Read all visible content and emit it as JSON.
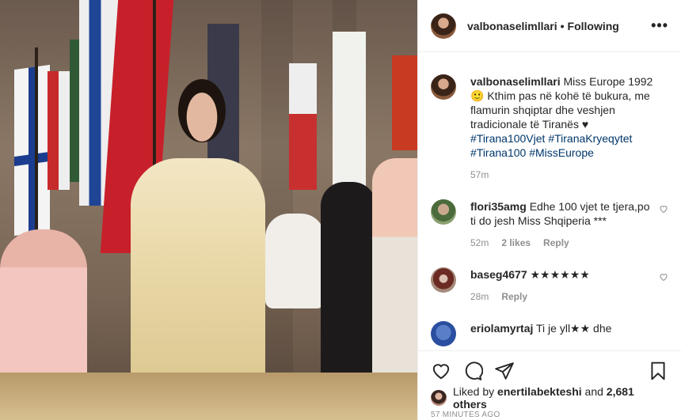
{
  "header": {
    "username": "valbonaselimllari",
    "separator": "•",
    "follow_label": "Following",
    "more_label": "•••"
  },
  "caption": {
    "username": "valbonaselimllari",
    "text": "Miss Europe 1992 🙂 Kthim pas në kohë të bukura, me flamurin shqiptar dhe veshjen tradicionale të Tiranës ♥",
    "hashtags": "#Tirana100Vjet #TiranaKryeqytet #Tirana100 #MissEurope",
    "time": "57m"
  },
  "comments": [
    {
      "username": "flori35amg",
      "text": "Edhe 100 vjet te tjera,po ti do jesh Miss Shqiperia ***",
      "time": "52m",
      "likes": "2 likes",
      "reply": "Reply"
    },
    {
      "username": "baseg4677",
      "text": "★★★★★★",
      "time": "28m",
      "reply": "Reply"
    },
    {
      "username": "eriolamyrtaj",
      "text": "Ti je yll★★ dhe",
      "time": "",
      "reply": ""
    }
  ],
  "likes": {
    "prefix": "Liked by",
    "user": "enertilabekteshi",
    "and": "and",
    "count": "2,681 others"
  },
  "timestamp": "57 MINUTES AGO",
  "icons": {
    "like": "heart-icon",
    "comment": "comment-icon",
    "share": "share-icon",
    "save": "bookmark-icon",
    "more": "more-icon"
  },
  "colors": {
    "text": "#262626",
    "muted": "#8e8e8e",
    "hashtag": "#00376b",
    "border": "#efefef"
  }
}
